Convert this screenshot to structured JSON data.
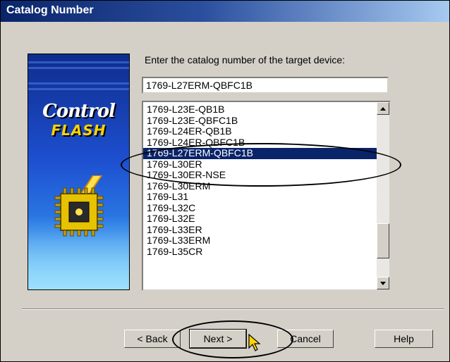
{
  "window": {
    "title": "Catalog Number"
  },
  "banner": {
    "line1": "Control",
    "line2": "FLASH"
  },
  "prompt": "Enter the catalog number of the target device:",
  "catalog_input": {
    "value": "1769-L27ERM-QBFC1B"
  },
  "catalog_list": {
    "items": [
      "1769-L23E-QB1B",
      "1769-L23E-QBFC1B",
      "1769-L24ER-QB1B",
      "1769-L24ER-QBFC1B",
      "1769-L27ERM-QBFC1B",
      "1769-L30ER",
      "1769-L30ER-NSE",
      "1769-L30ERM",
      "1769-L31",
      "1769-L32C",
      "1769-L32E",
      "1769-L33ER",
      "1769-L33ERM",
      "1769-L35CR"
    ],
    "selected": "1769-L27ERM-QBFC1B"
  },
  "buttons": {
    "back": "< Back",
    "next": "Next >",
    "cancel": "Cancel",
    "help": "Help"
  },
  "colors": {
    "selection": "#0a246a",
    "dialog_face": "#d4d0c8",
    "title_gradient_start": "#0a246a",
    "title_gradient_end": "#a6caf0"
  }
}
